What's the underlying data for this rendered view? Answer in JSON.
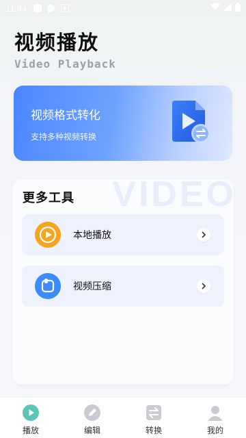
{
  "status_bar": {
    "time": "11:44"
  },
  "header": {
    "title": "视频播放",
    "subtitle": "Video Playback"
  },
  "convert_card": {
    "title": "视频格式转化",
    "description": "支持多种视频转换"
  },
  "tools": {
    "title": "更多工具",
    "watermark": "VIDEO",
    "items": [
      {
        "label": "本地播放",
        "icon": "play-circle-icon",
        "color": "#f5a623"
      },
      {
        "label": "视频压缩",
        "icon": "compress-icon",
        "color": "#3d8bff"
      }
    ]
  },
  "bottom_nav": {
    "items": [
      {
        "label": "播放",
        "icon": "play-icon",
        "active": true
      },
      {
        "label": "编辑",
        "icon": "pencil-icon",
        "active": false
      },
      {
        "label": "转换",
        "icon": "swap-icon",
        "active": false
      },
      {
        "label": "我的",
        "icon": "user-icon",
        "active": false
      }
    ]
  },
  "colors": {
    "accent": "#4a86ff",
    "active_nav": "#5bc6b8"
  }
}
